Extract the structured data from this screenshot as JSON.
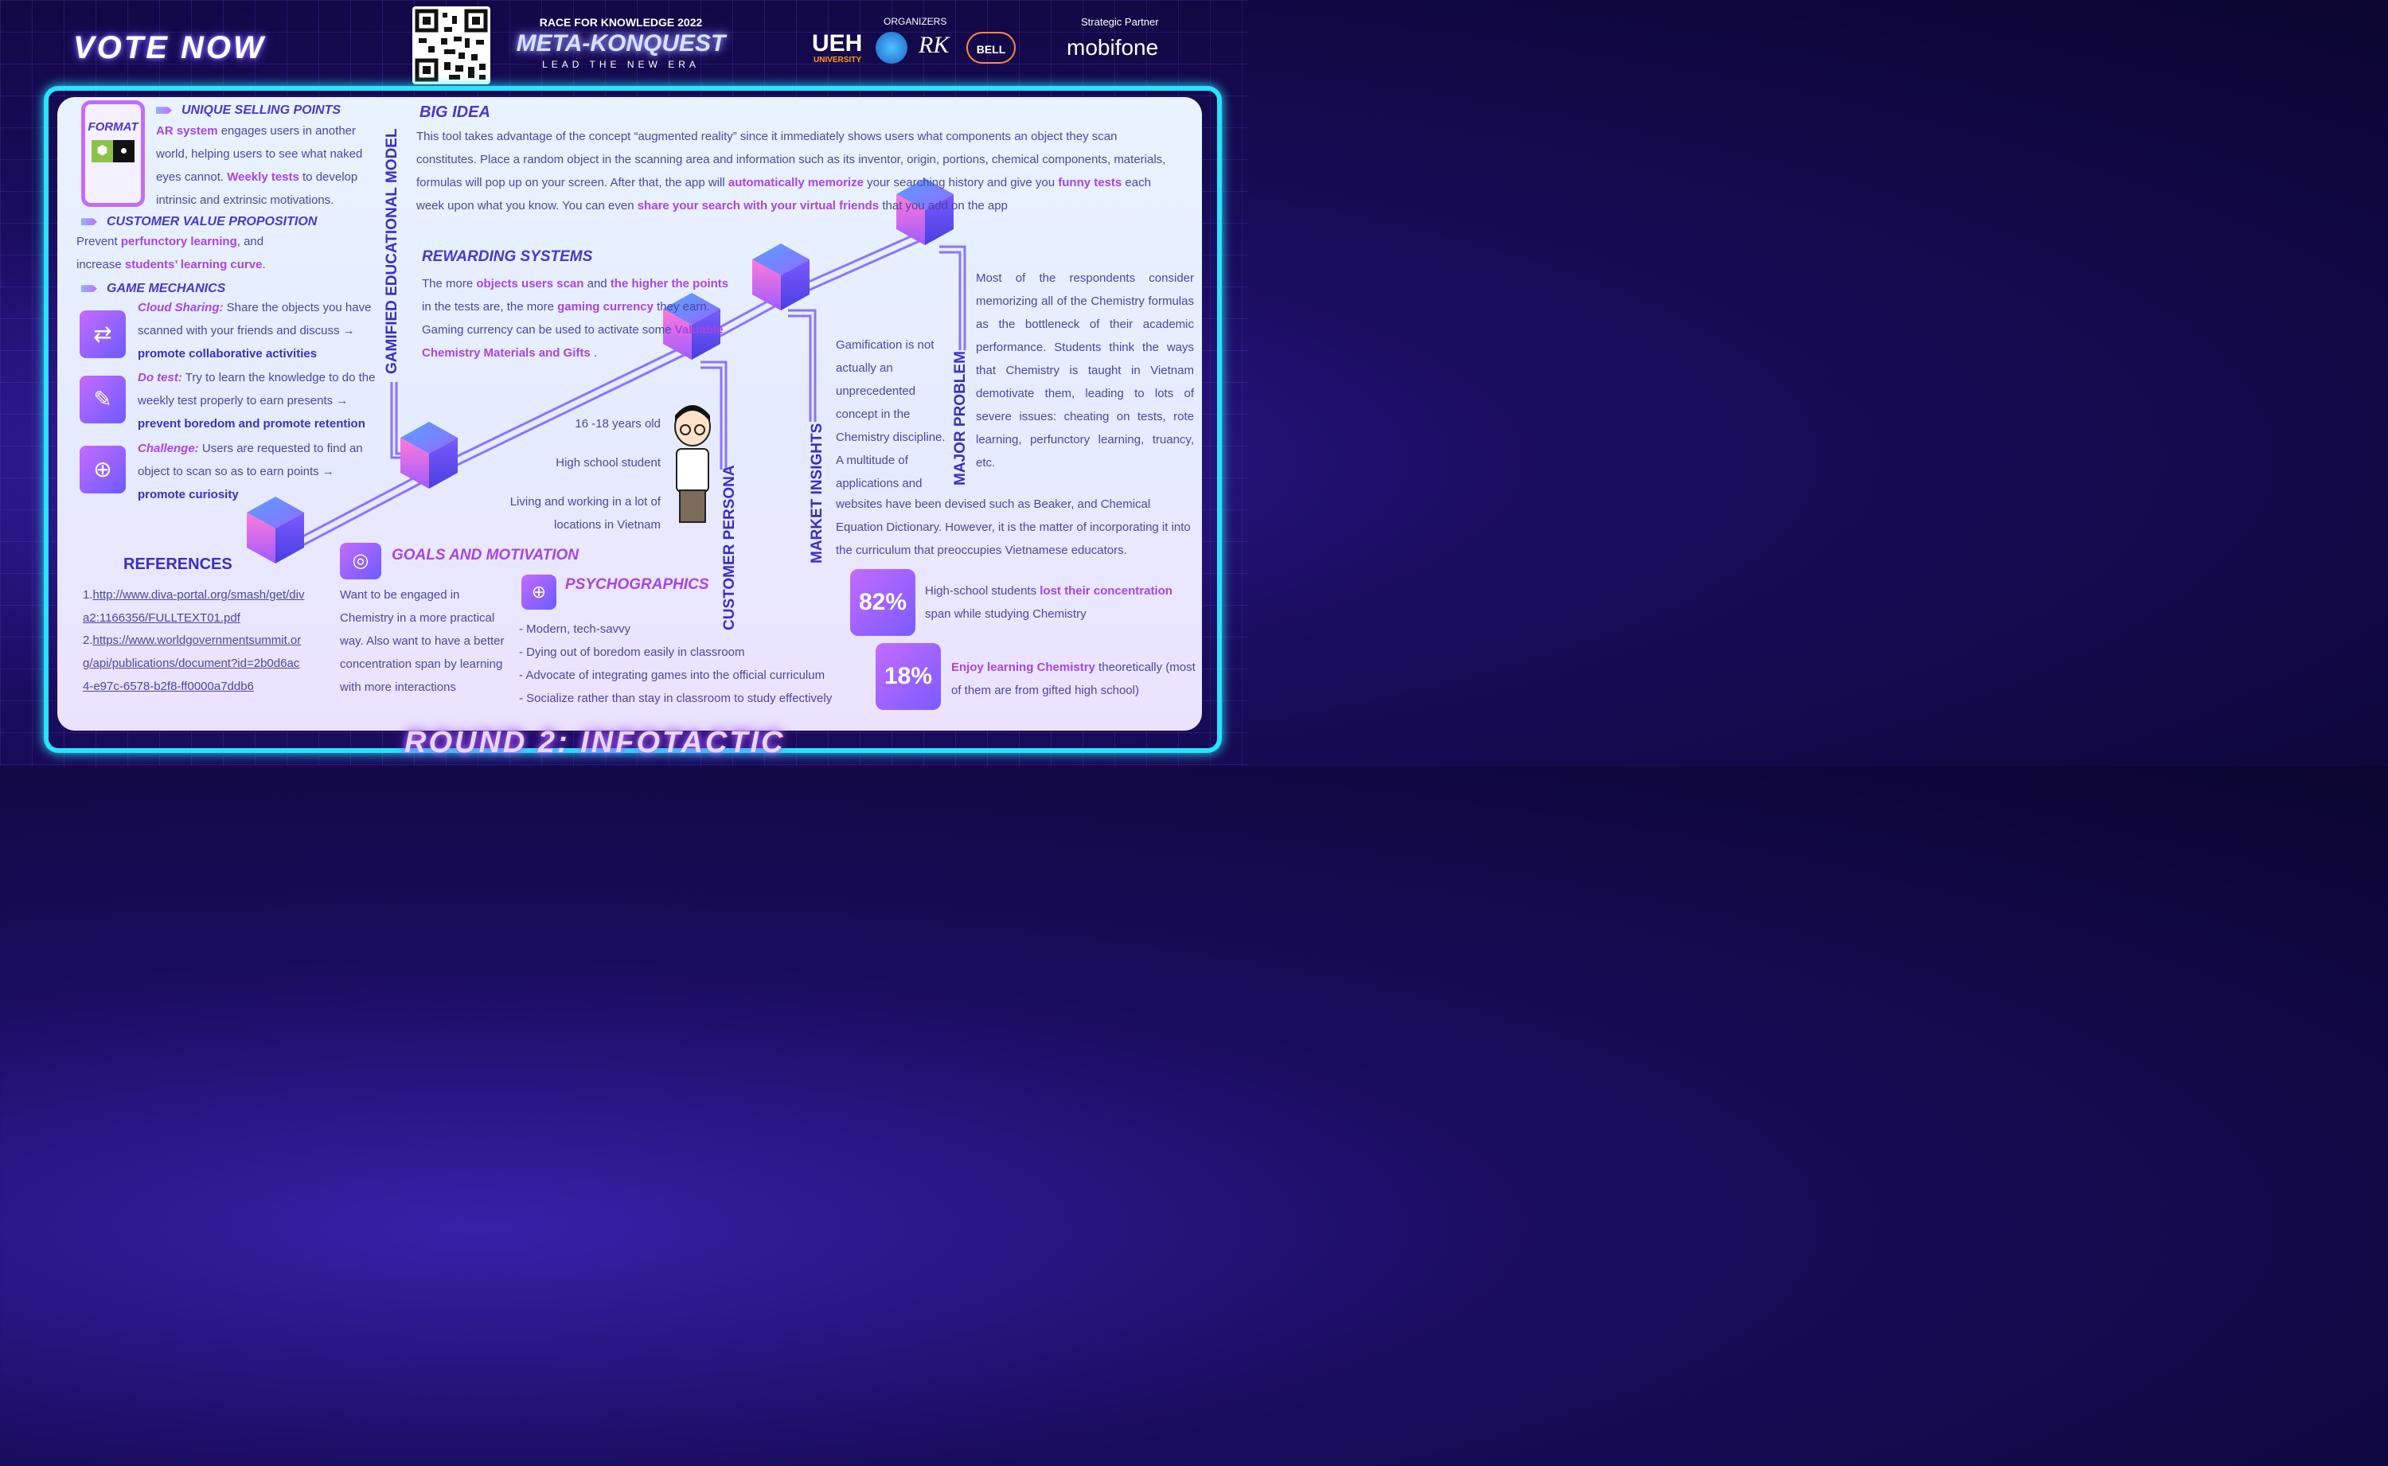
{
  "header": {
    "vote_label": "VOTE NOW",
    "race_title": "RACE FOR KNOWLEDGE 2022",
    "event_title": "META-KONQUEST",
    "tagline": "LEAD THE NEW ERA",
    "organizers_label": "ORGANIZERS",
    "ueh_logo": "UEH",
    "ueh_sub": "UNIVERSITY",
    "bell_logo": "BELL",
    "partner_label": "Strategic Partner",
    "partner_name": "mobifone"
  },
  "footer": {
    "round_title": "ROUND 2: INFOTACTIC"
  },
  "format": {
    "label": "FORMAT"
  },
  "usp": {
    "heading": "UNIQUE SELLING POINTS",
    "p1_hl": "AR system",
    "p1": " engages users in another world, helping users to see what naked eyes cannot. ",
    "p2_hl": "Weekly tests",
    "p2": " to develop intrinsic and extrinsic motivations."
  },
  "cvp": {
    "heading": "CUSTOMER VALUE PROPOSITION",
    "t1": "Prevent ",
    "h1": "perfunctory learning",
    "t2": ", and increase ",
    "h2": "students’ learning curve",
    "t3": "."
  },
  "mechanics": {
    "heading": "GAME MECHANICS",
    "items": [
      {
        "title": "Cloud Sharing:",
        "text": " Share the objects you have scanned with your friends and discuss → ",
        "hl": "promote collaborative activities",
        "icon": "shuffle-icon"
      },
      {
        "title": "Do test:",
        "text": " Try to learn the knowledge to do the weekly test properly to earn presents → ",
        "hl": "prevent boredom and promote retention",
        "icon": "test-edit-icon"
      },
      {
        "title": "Challenge:",
        "text": " Users are requested to find an object to scan so as to earn points → ",
        "hl": "promote curiosity",
        "icon": "globe-search-icon"
      }
    ]
  },
  "gamified_label": "GAMIFIED EDUCATIONAL MODEL",
  "big_idea": {
    "heading": "BIG IDEA",
    "t1": "This tool takes advantage of the concept “augmented reality” since it immediately shows users what components an object they scan constitutes. Place a random object in the scanning area and information such as its inventor, origin, portions, chemical components, materials, formulas will pop up on your screen. After that, the app will ",
    "h1": "automatically memorize",
    "t2": " your searching history and give you ",
    "h2": "funny tests",
    "t3": " each week upon what you know. You can even ",
    "h3": "share your search with your virtual friends",
    "t4": " that you add on the app"
  },
  "rewarding": {
    "heading": "REWARDING SYSTEMS",
    "t1": "The more ",
    "h1": "objects users scan",
    "t2": " and ",
    "h2": "the higher the points",
    "t3": " in the tests are, the more ",
    "h3": "gaming currency",
    "t4": " they earn. Gaming currency can be used to activate some ",
    "h4": "Valuable Chemistry Materials and Gifts",
    "t5": " ."
  },
  "persona": {
    "label": "CUSTOMER PERSONA",
    "age": "16 -18 years old",
    "role": "High school student",
    "location": "Living and working in a lot of locations in Vietnam"
  },
  "market": {
    "label": "MARKET INSIGHTS",
    "text1": "Gamification is not actually an unprecedented concept in the Chemistry discipline. A multitude of applications and",
    "text2": "websites have been devised such as Beaker, and Chemical Equation Dictionary. However, it is the matter of incorporating it into the curriculum that preoccupies Vietnamese educators."
  },
  "problem": {
    "label": "MAJOR PROBLEM",
    "text": "Most of the respondents consider memorizing all of the Chemistry formulas as the bottleneck of their academic performance. Students think the ways that Chemistry is taught in Vietnam demotivate them, leading to lots of severe issues: cheating on tests, rote learning, perfunctory learning, truancy, etc."
  },
  "stats": [
    {
      "value": "82%",
      "t1": "High-school students ",
      "hl": "lost their concentration",
      "t2": " span while studying Chemistry"
    },
    {
      "value": "18%",
      "t1": "",
      "hl": "Enjoy learning Chemistry",
      "t2": " theoretically (most of them are from gifted high school)"
    }
  ],
  "references": {
    "heading": "REFERENCES",
    "items": [
      {
        "num": "1.",
        "url": "http://www.diva-portal.org/smash/get/diva2:1166356/FULLTEXT01.pdf"
      },
      {
        "num": "2.",
        "url": "https://www.worldgovernmentsummit.org/api/publications/document?id=2b0d6ac4-e97c-6578-b2f8-ff0000a7ddb6"
      }
    ]
  },
  "goals": {
    "heading": "GOALS AND MOTIVATION",
    "text": "Want to be engaged in Chemistry in a more practical way. Also want to have a better concentration span by learning with more interactions"
  },
  "psycho": {
    "heading": "PSYCHOGRAPHICS",
    "items": [
      "- Modern, tech-savvy",
      "- Dying out of boredom easily in classroom",
      "- Advocate of integrating games into the official curriculum",
      "- Socialize rather than stay in classroom to study effectively"
    ]
  },
  "colors": {
    "accent": "#a845e0",
    "heading": "#4a37c8",
    "frame": "#27e3ff"
  }
}
